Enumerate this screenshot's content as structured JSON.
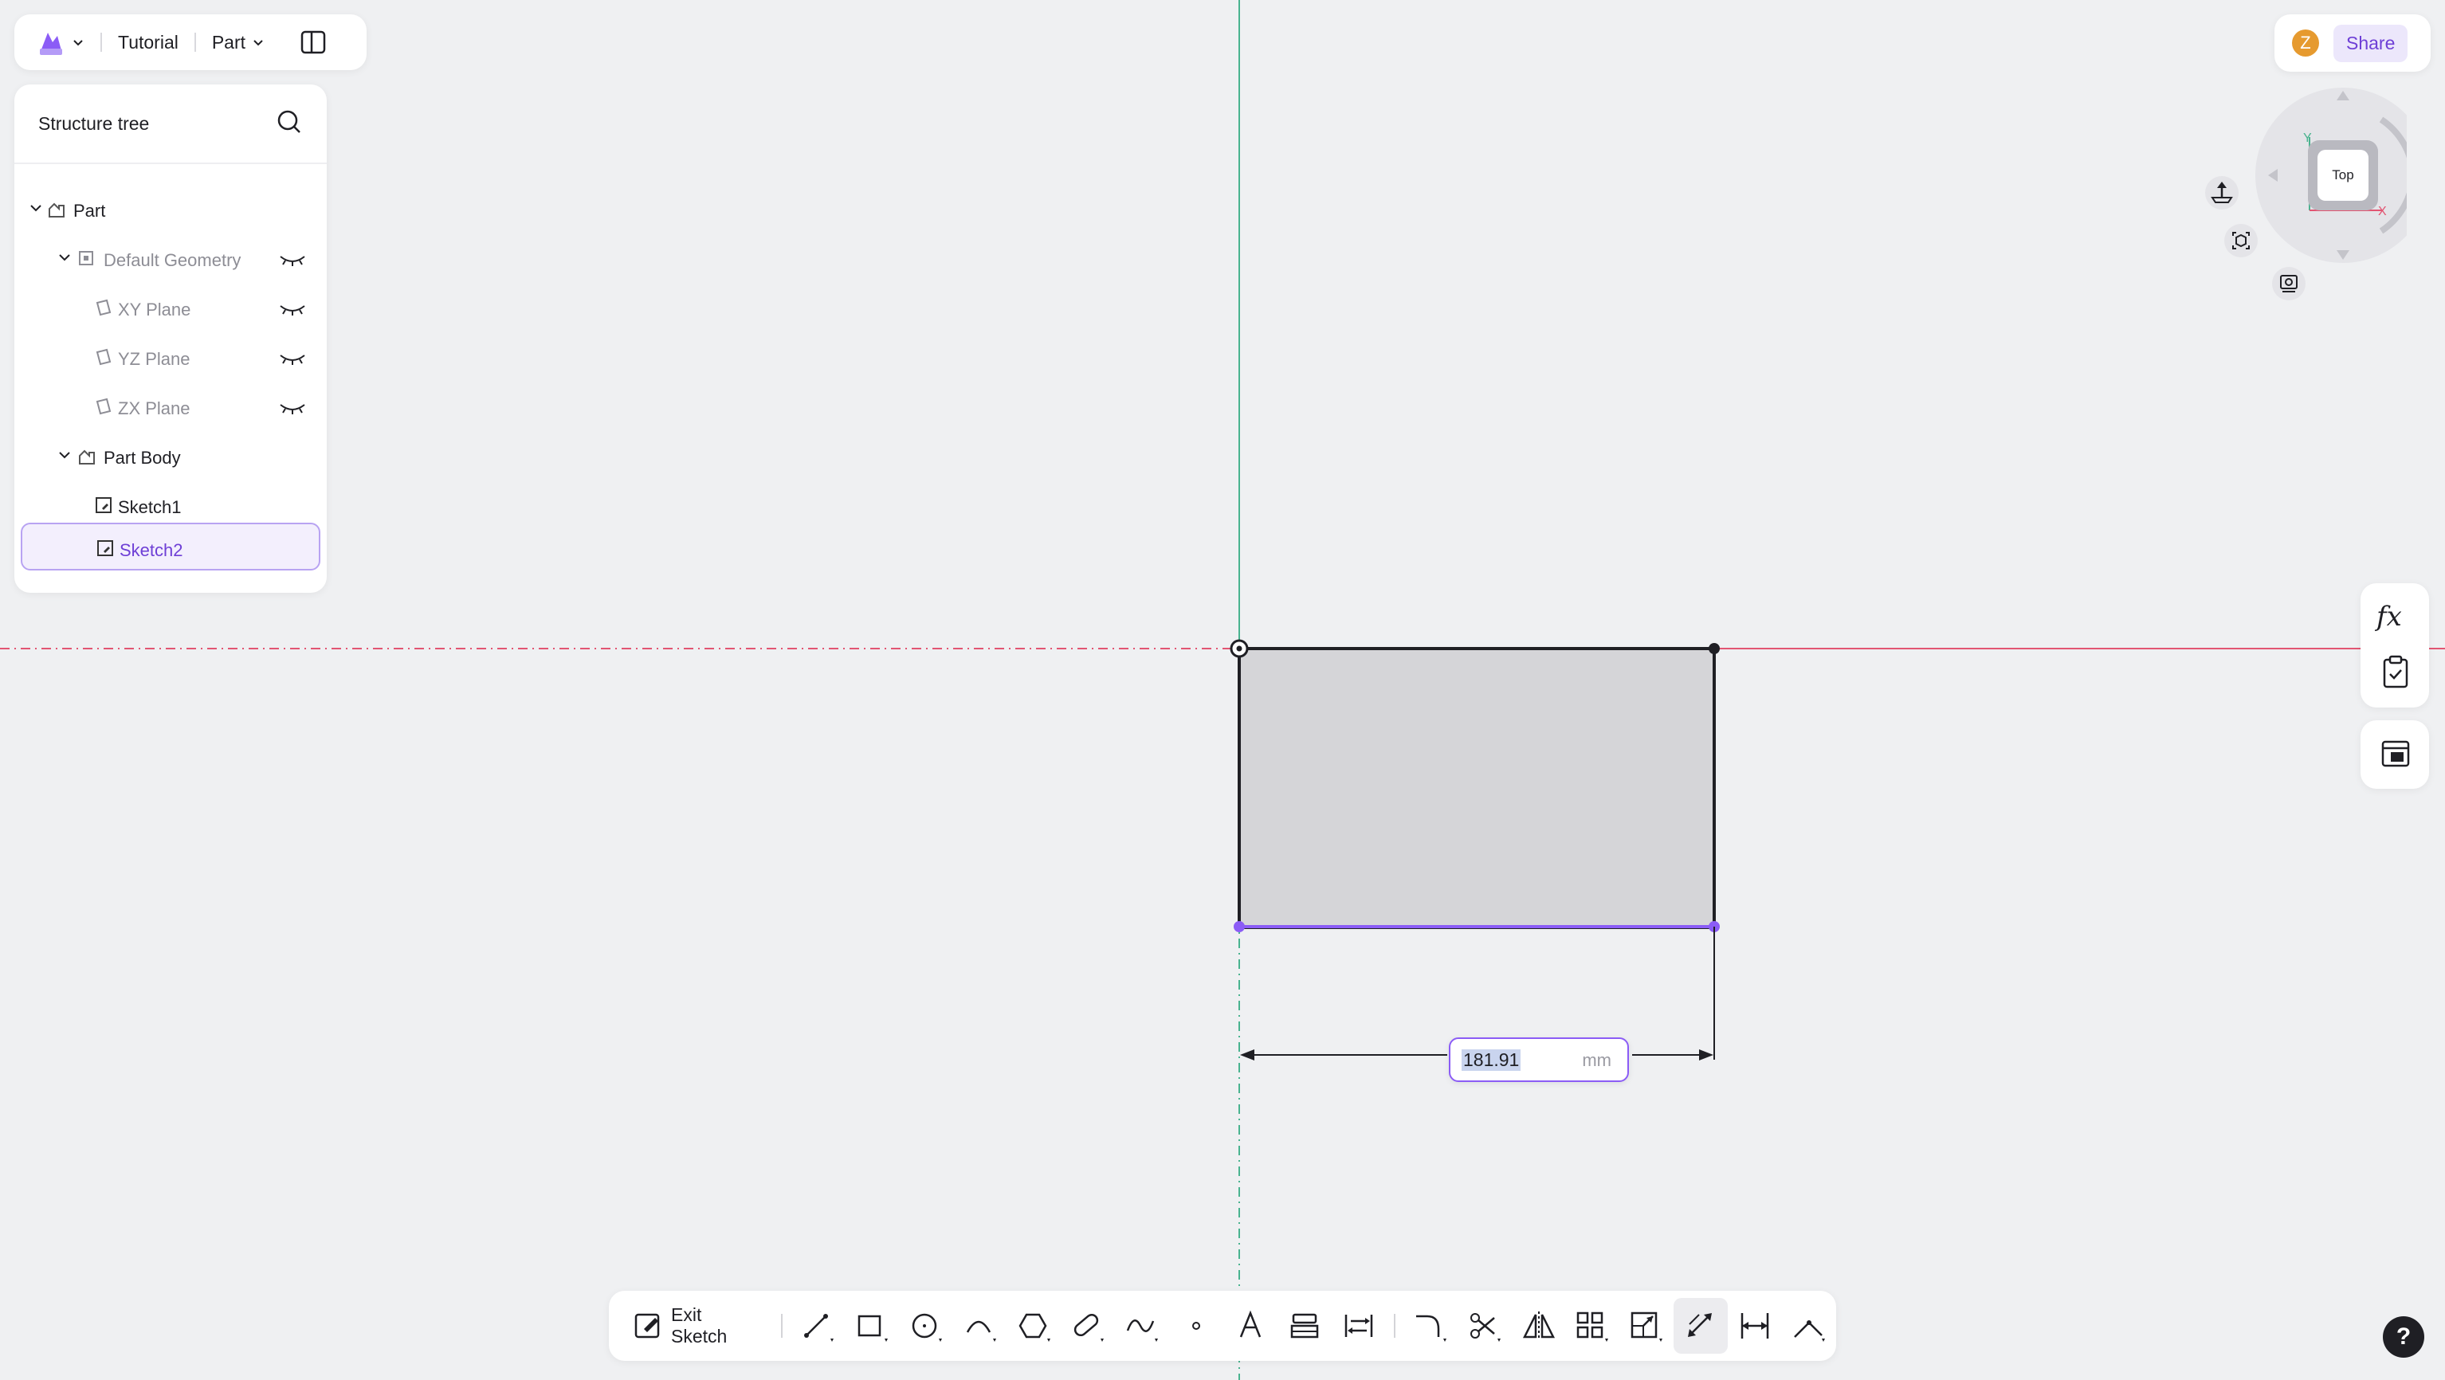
{
  "topbar": {
    "project": "Tutorial",
    "mode": "Part"
  },
  "tree": {
    "title": "Structure tree",
    "items": [
      {
        "label": "Part"
      },
      {
        "label": "Default Geometry"
      },
      {
        "label": "XY Plane"
      },
      {
        "label": "YZ Plane"
      },
      {
        "label": "ZX Plane"
      },
      {
        "label": "Part Body"
      },
      {
        "label": "Sketch1"
      },
      {
        "label": "Sketch2"
      }
    ]
  },
  "header_right": {
    "avatar_initial": "Z",
    "share_label": "Share"
  },
  "view_cube": {
    "face": "Top"
  },
  "dimension": {
    "value": "181.91",
    "unit": "mm"
  },
  "toolbar": {
    "exit_label": "Exit Sketch"
  },
  "side_tools": {
    "formula_label": "fx"
  },
  "help": {
    "label": "?"
  },
  "colors": {
    "accent": "#8b5cf6",
    "x_axis": "#e25572",
    "y_axis": "#49b38f"
  }
}
